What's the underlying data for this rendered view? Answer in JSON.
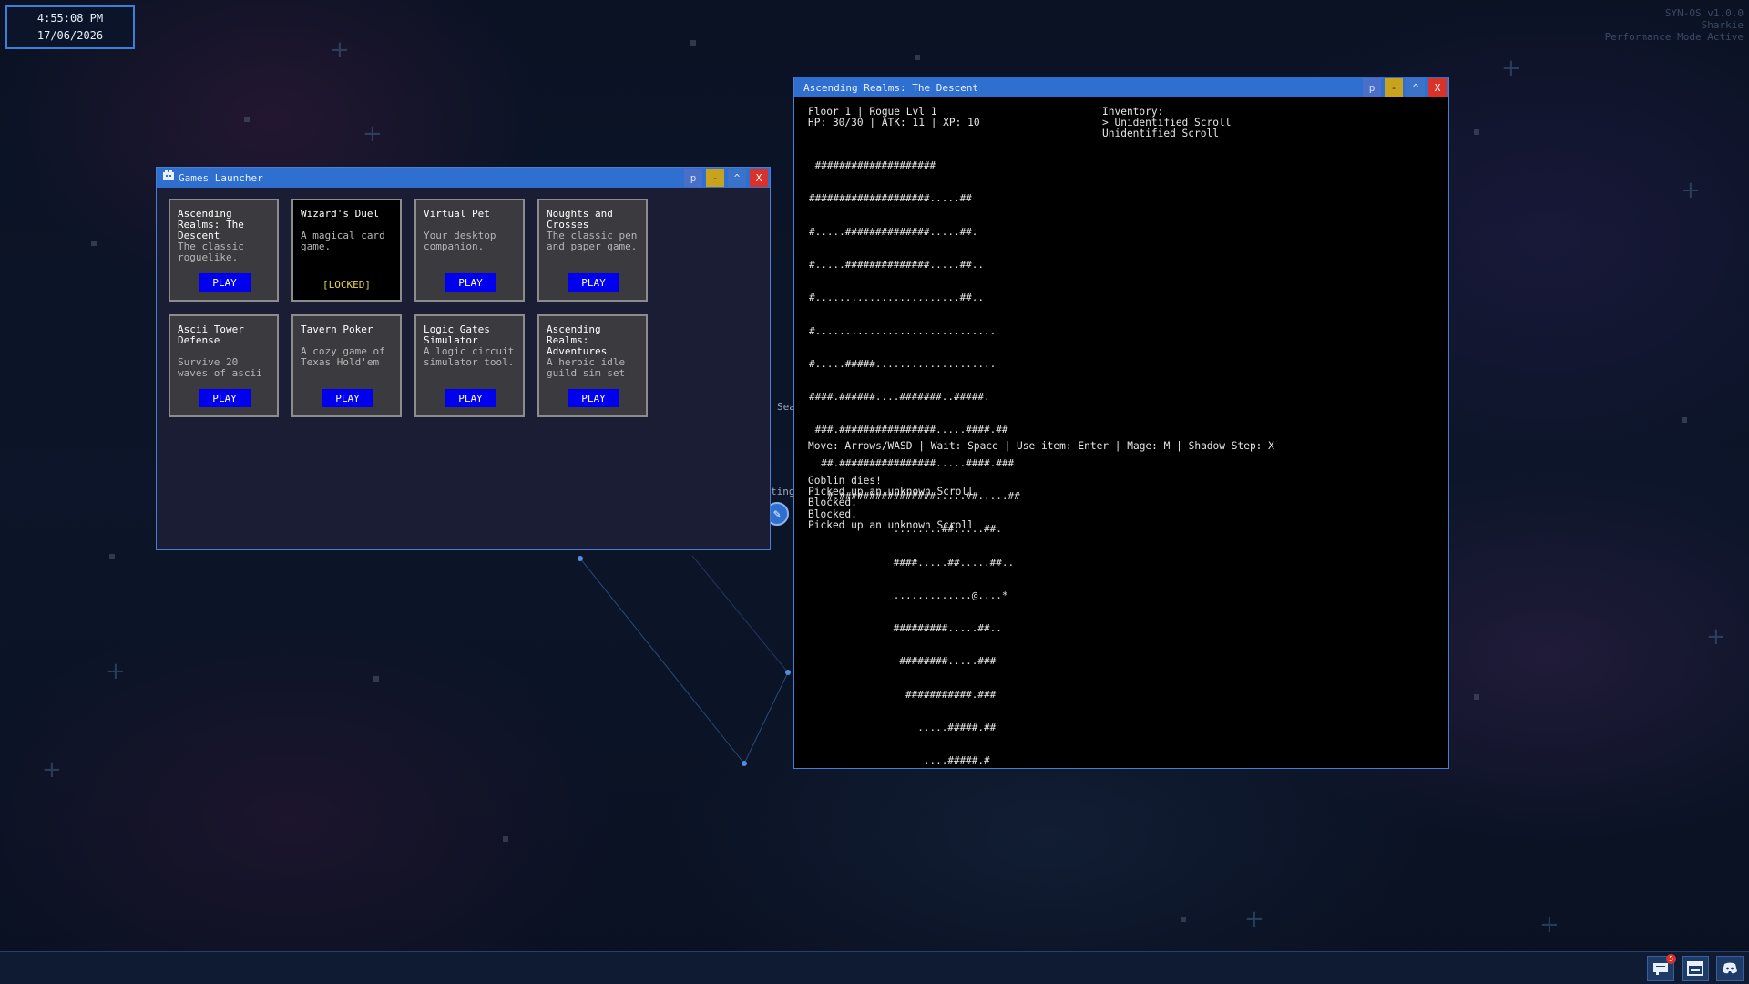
{
  "clock": {
    "time": "4:55:08 PM",
    "date": "17/06/2026"
  },
  "system": {
    "version": "SYN-OS v1.0.0",
    "user": "Sharkie",
    "mode": "Performance Mode Active"
  },
  "desktop": {
    "label_1": "Sea",
    "label_2": "ting"
  },
  "launcher": {
    "title": "Games Launcher",
    "buttons": {
      "p": "p",
      "minimize": "-",
      "maximize": "^",
      "close": "X"
    },
    "games": [
      {
        "title": "Ascending Realms: The Descent",
        "desc": "The classic roguelike.",
        "action": "PLAY"
      },
      {
        "title": "Wizard's Duel",
        "desc": "A magical card game.",
        "status": "[LOCKED]"
      },
      {
        "title": "Virtual Pet",
        "desc": "Your desktop companion.",
        "action": "PLAY"
      },
      {
        "title": "Noughts and Crosses",
        "desc": "The classic pen and paper game.",
        "action": "PLAY"
      },
      {
        "title": "Ascii Tower Defense",
        "desc": "Survive 20 waves of ascii",
        "action": "PLAY"
      },
      {
        "title": "Tavern Poker",
        "desc": "A cozy game of Texas Hold'em",
        "action": "PLAY"
      },
      {
        "title": "Logic Gates Simulator",
        "desc": "A logic circuit simulator tool.",
        "action": "PLAY"
      },
      {
        "title": "Ascending Realms: Adventures",
        "desc": "A heroic idle guild sim set",
        "action": "PLAY"
      }
    ]
  },
  "game": {
    "title": "Ascending Realms: The Descent",
    "buttons": {
      "p": "p",
      "minimize": "-",
      "maximize": "^",
      "close": "X"
    },
    "status_line": "Floor 1 | Rogue Lvl 1",
    "stats_line": "HP: 30/30 | ATK: 11 | XP: 10",
    "inventory": {
      "label": "Inventory:",
      "items": [
        "> Unidentified Scroll",
        "Unidentified Scroll"
      ]
    },
    "map": [
      " ####################",
      "####################.....##",
      "#.....##############.....##.",
      "#.....##############.....##..",
      "#........................##..",
      "#..............................",
      "#.....#####....................",
      "####.######....#######..#####.",
      " ###.################.....####.##",
      "  ##.################.....####.###",
      "   #.################.....##.....##",
      "              ........##.....##.",
      "              ####.....##.....##..",
      "              .............@....*",
      "              #########.....##..",
      "               ########.....###",
      "                ###########.###",
      "                  .....#####.##",
      "                   ....#####.#"
    ],
    "controls": "Move: Arrows/WASD | Wait: Space | Use item: Enter | Mage: M | Shadow Step: X",
    "log": [
      "Goblin dies!",
      "Picked up an unknown Scroll",
      "Blocked.",
      "Blocked.",
      "Picked up an unknown Scroll"
    ]
  },
  "taskbar": {
    "notification_count": "5"
  }
}
